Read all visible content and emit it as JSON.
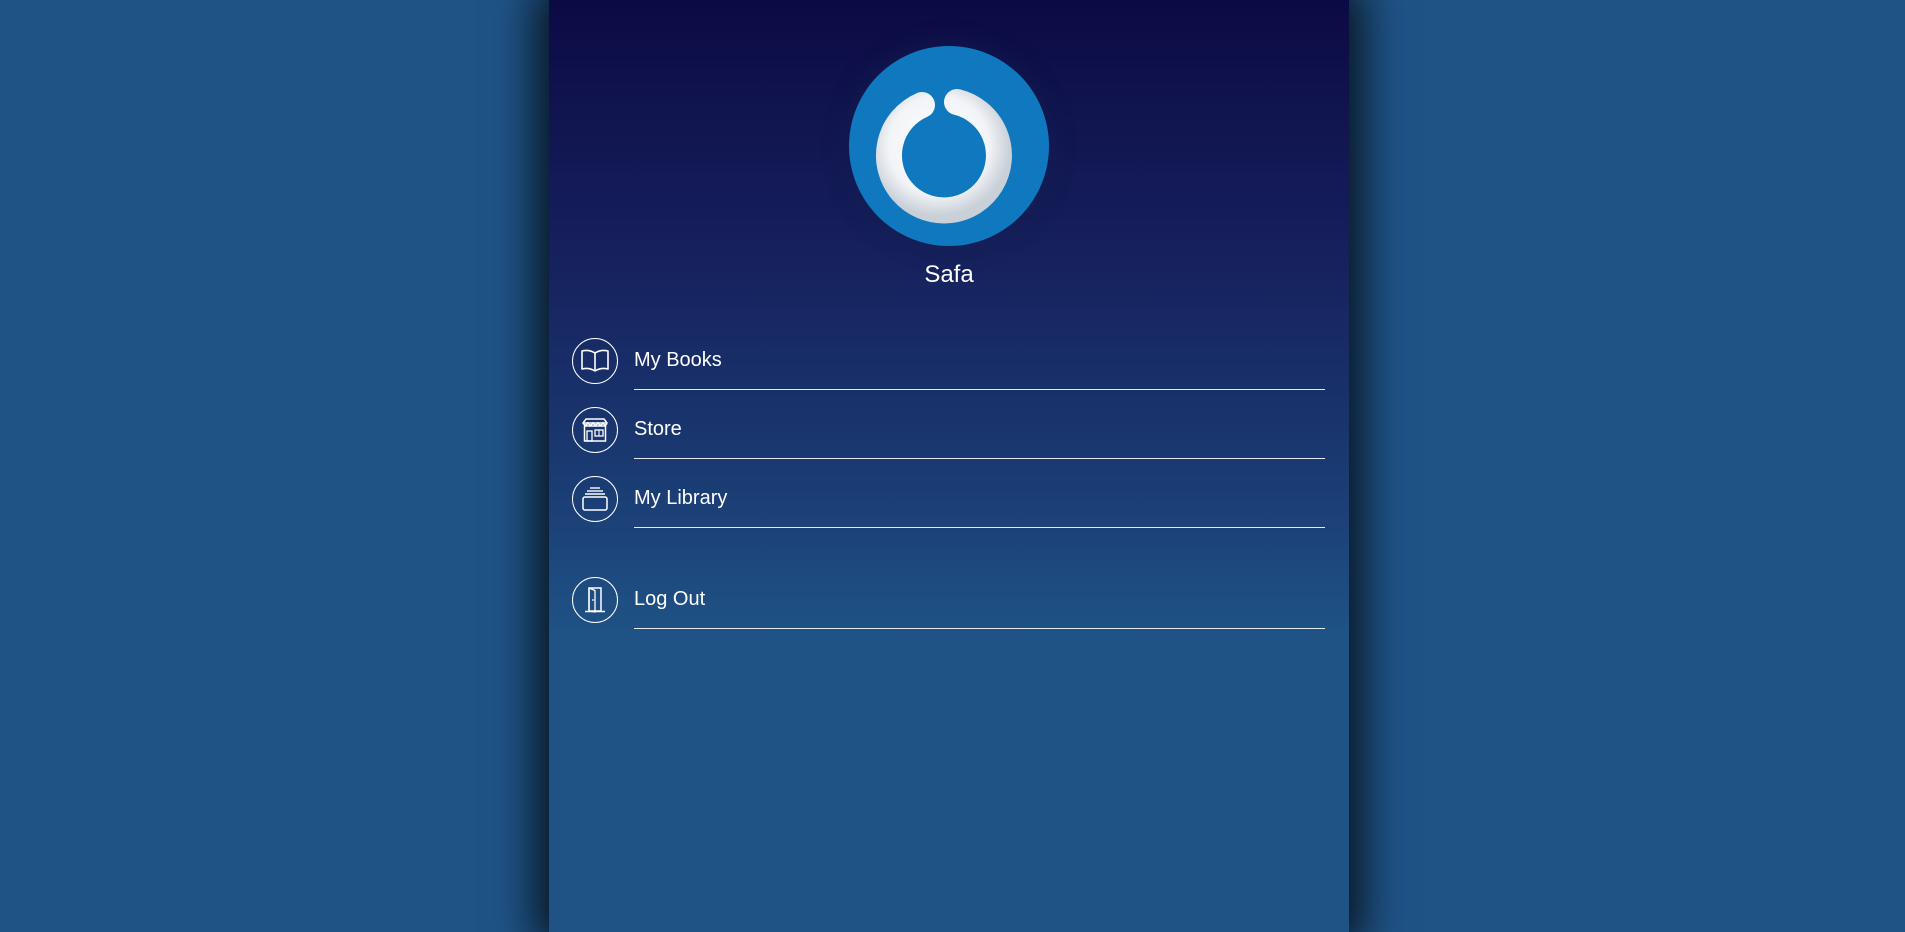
{
  "user": {
    "name": "Safa",
    "avatar_icon": "power-logo-icon"
  },
  "menu": {
    "items": [
      {
        "label": "My Books",
        "icon": "open-book-icon"
      },
      {
        "label": "Store",
        "icon": "storefront-icon"
      },
      {
        "label": "My Library",
        "icon": "library-stack-icon"
      },
      {
        "label": "Log Out",
        "icon": "door-icon"
      }
    ]
  },
  "colors": {
    "page_background": "#1f5386",
    "panel_top": "#0c0a45",
    "panel_bottom": "#1f5386",
    "avatar_blue": "#0f78be",
    "text": "#ffffff"
  }
}
